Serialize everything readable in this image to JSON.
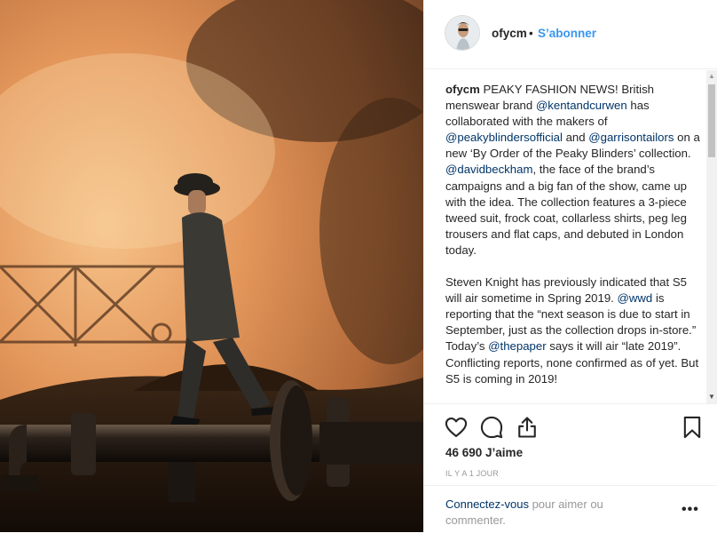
{
  "post": {
    "username": "ofycm",
    "separator": "•",
    "follow_label": "S’abonner",
    "caption": {
      "p1_user": "ofycm",
      "p1_a": " PEAKY FASHION NEWS! British menswear brand ",
      "m1": "@kentandcurwen",
      "p1_b": " has collaborated with the makers of ",
      "m2": "@peakyblindersofficial",
      "p1_c": " and ",
      "m3": "@garrisontailors",
      "p1_d": " on a new ‘By Order of the Peaky Blinders’ collection. ",
      "m4": "@davidbeckham",
      "p1_e": ", the face of the brand’s campaigns and a big fan of the show, came up with the idea. The collection features a 3-piece tweed suit, frock coat, collarless shirts, peg leg trousers and flat caps, and debuted in London today.",
      "p2_a": "Steven Knight has previously indicated that S5 will air sometime in Spring 2019. ",
      "m5": "@wwd",
      "p2_b": " is reporting that the “next season is due to start in September, just as the collection drops in-store.” Today’s ",
      "m6": "@thepaper",
      "p2_c": " says it will air “late 2019”. Conflicting reports, none confirmed as of yet. But S5 is coming in 2019!"
    },
    "likes": "46 690 J’aime",
    "timestamp": "IL Y A 1 JOUR",
    "comment_link": "Connectez-vous",
    "comment_rest": " pour aimer ou commenter.",
    "more_label": "•••"
  },
  "icons": {
    "like": "heart-icon",
    "comment": "comment-icon",
    "share": "share-icon",
    "save": "bookmark-icon",
    "more": "more-options-icon"
  },
  "colors": {
    "link": "#3897f0",
    "mention": "#003569",
    "muted": "#999999",
    "text": "#262626",
    "border": "#efefef"
  }
}
